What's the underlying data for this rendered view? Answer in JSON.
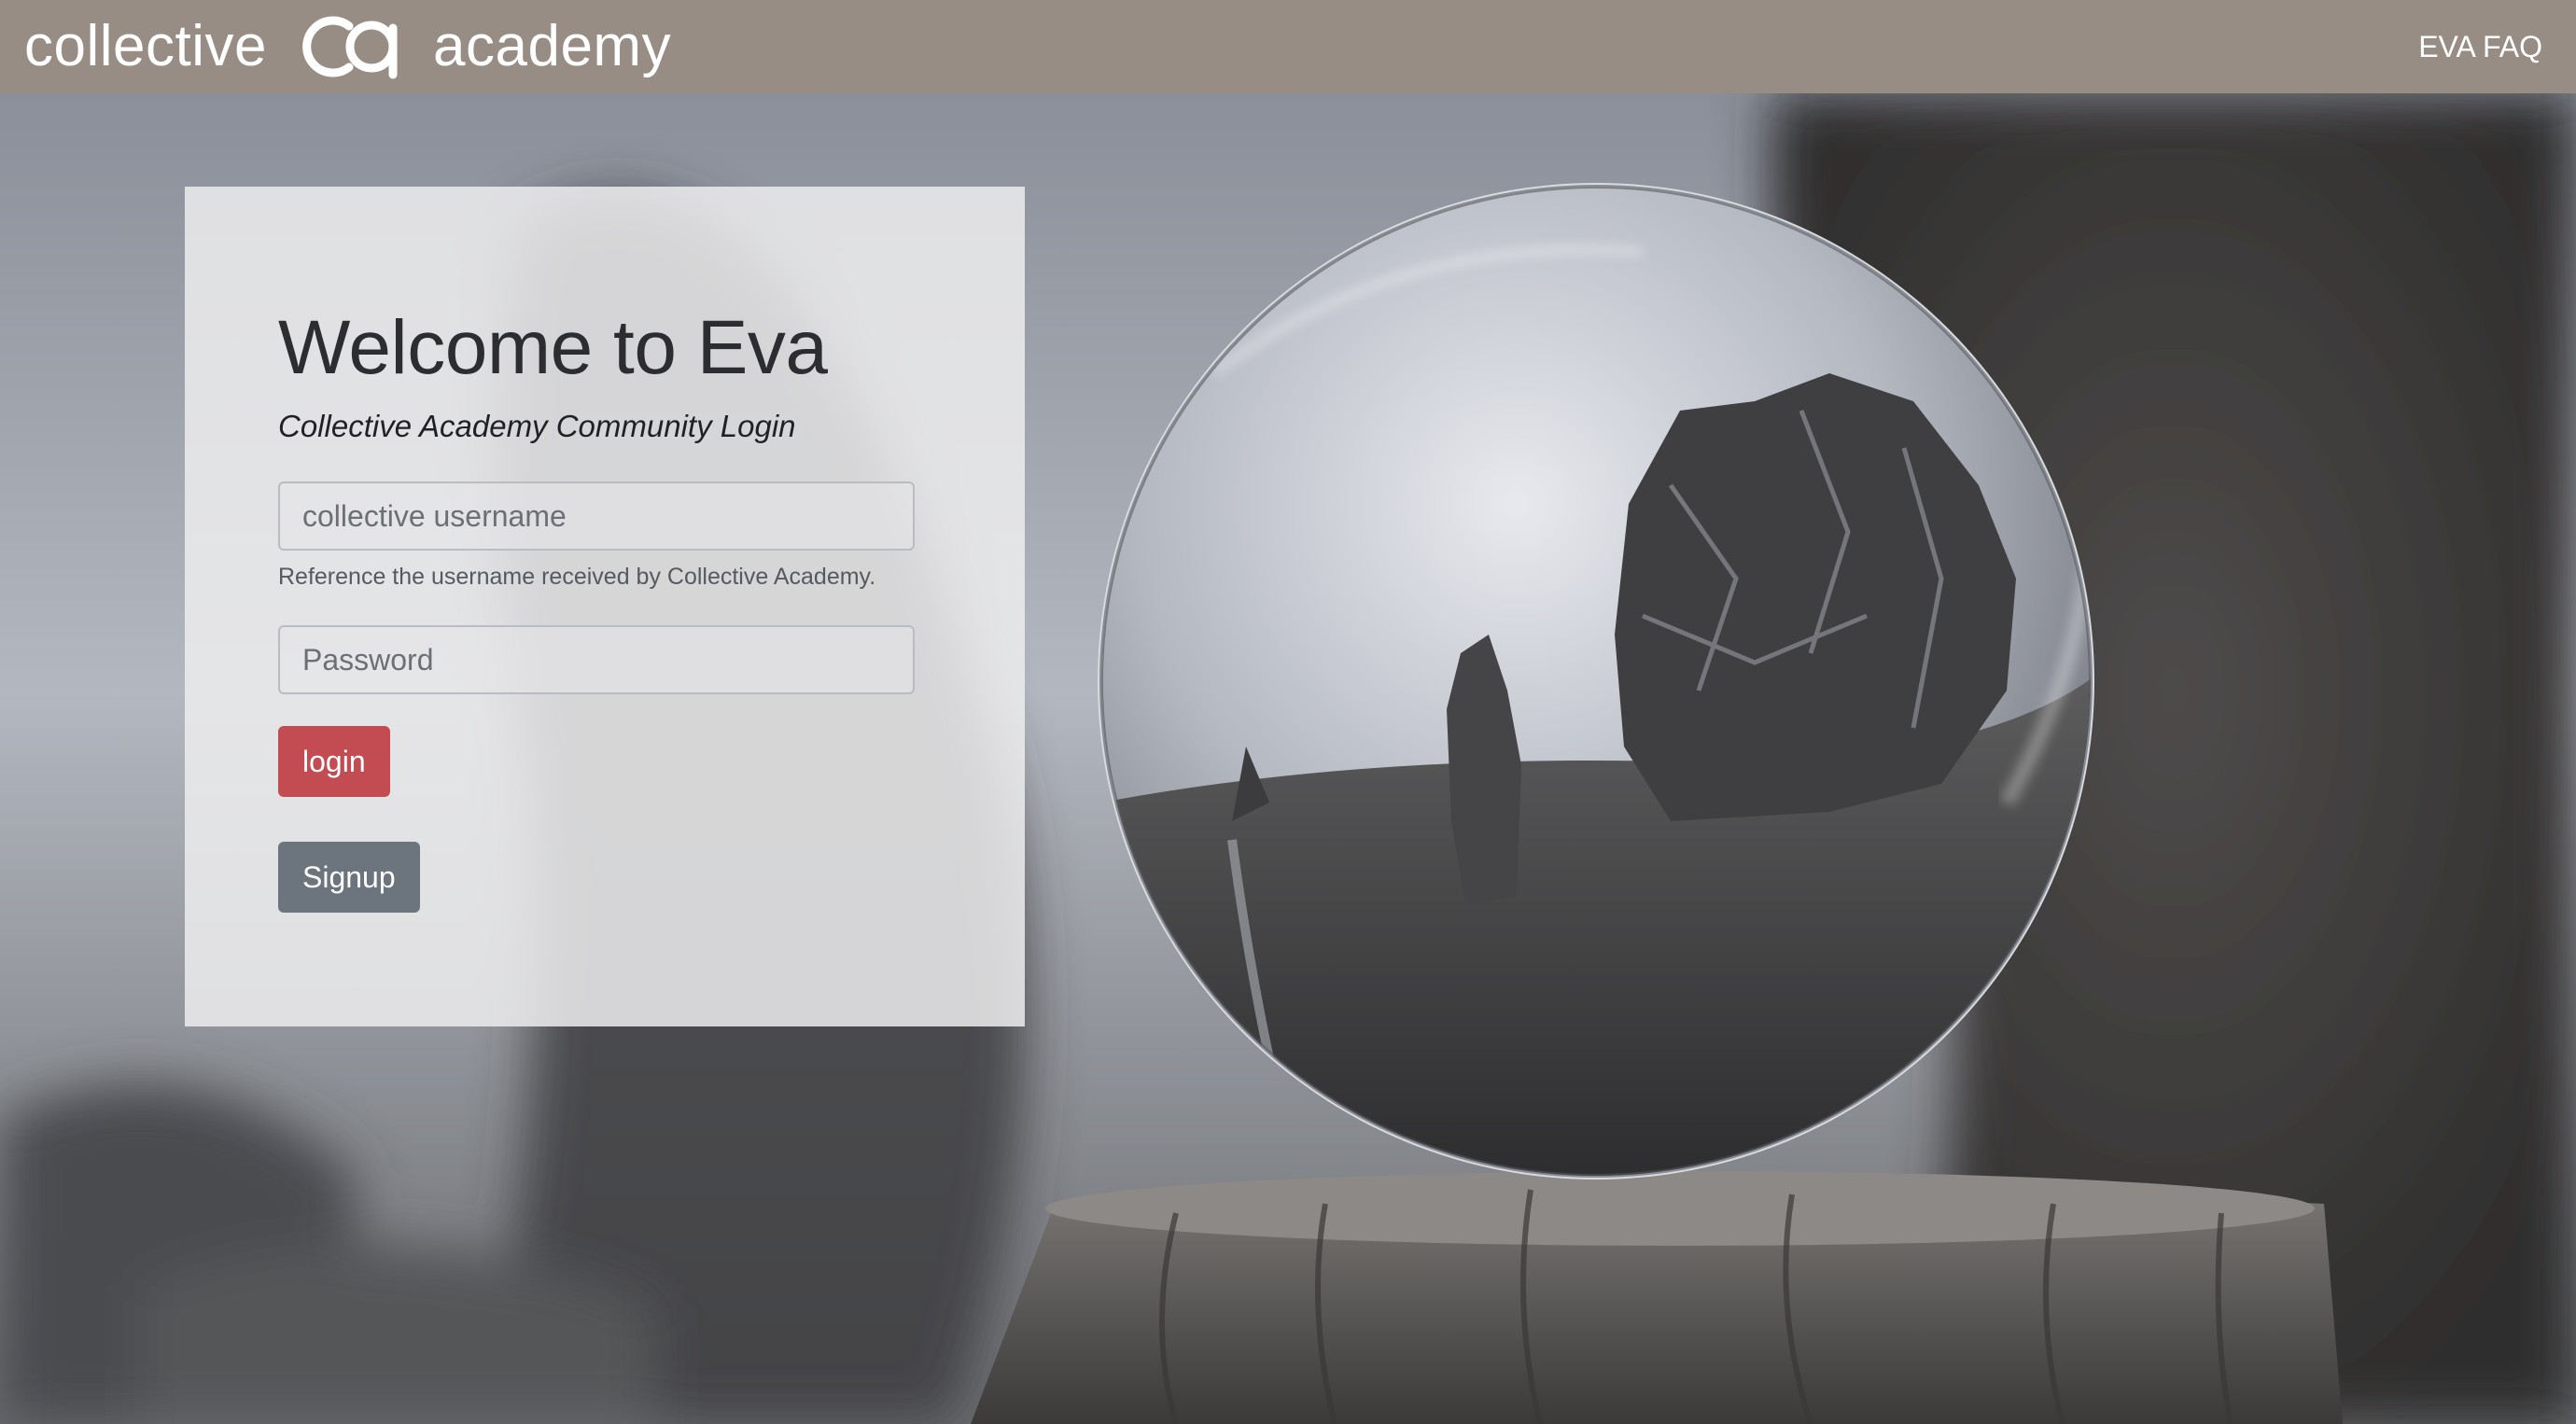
{
  "navbar": {
    "brand_left": "collective",
    "brand_right": "academy",
    "faq_link": "EVA FAQ"
  },
  "login": {
    "title": "Welcome to Eva",
    "subtitle": "Collective Academy Community Login",
    "username_placeholder": "collective username",
    "username_help": "Reference the username received by Collective Academy.",
    "password_placeholder": "Password",
    "login_label": "login",
    "signup_label": "Signup"
  },
  "colors": {
    "navbar_bg": "#988d84",
    "login_button": "#c24c52",
    "signup_button": "#6c757d"
  },
  "icons": [
    "collective-academy-logo-icon"
  ]
}
